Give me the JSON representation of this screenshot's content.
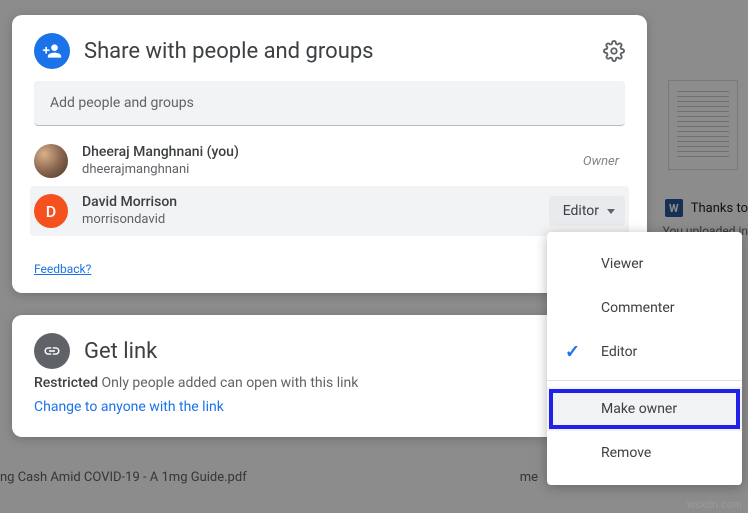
{
  "share": {
    "title": "Share with people and groups",
    "input_placeholder": "Add people and groups",
    "feedback_label": "Feedback?",
    "people": [
      {
        "name": "Dheeraj Manghnani (you)",
        "email": "dheerajmanghnani",
        "role": "Owner",
        "initial": ""
      },
      {
        "name": "David Morrison",
        "email": "morrisondavid",
        "role": "Editor",
        "initial": "D"
      }
    ]
  },
  "link": {
    "title": "Get link",
    "restricted_label": "Restricted",
    "restricted_text": "Only people added can open with this link",
    "change_link": "Change to anyone with the link"
  },
  "dropdown": {
    "items": [
      "Viewer",
      "Commenter",
      "Editor",
      "Make owner",
      "Remove"
    ],
    "selected": "Editor",
    "highlighted": "Make owner"
  },
  "background": {
    "file_title": "ng Cash Amid COVID-19 - A 1mg Guide.pdf",
    "owner": "me",
    "side_item": "Thanks to",
    "side_sub": "You uploaded in",
    "watermark": "wsxdn.com"
  }
}
